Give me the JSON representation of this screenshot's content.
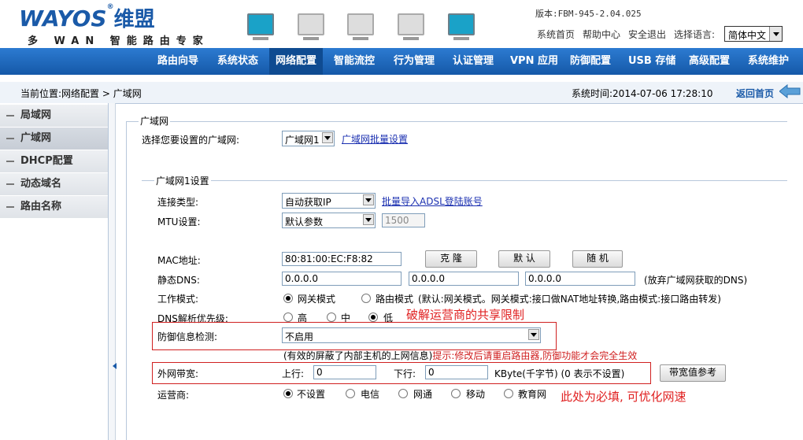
{
  "header": {
    "logo_text": "WAYOS",
    "logo_cn": "维盟",
    "logo_reg": "®",
    "tagline": "多 WAN 智能路由专家",
    "version": "版本:FBM-945-2.04.025",
    "links": [
      "系统首页",
      "帮助中心",
      "安全退出"
    ],
    "lang_label": "选择语言:",
    "lang_value": "简体中文"
  },
  "nav": {
    "items": [
      "路由向导",
      "系统状态",
      "网络配置",
      "智能流控",
      "行为管理",
      "认证管理",
      "VPN 应用",
      "防御配置",
      "USB 存储",
      "高级配置",
      "系统维护"
    ],
    "active": "网络配置"
  },
  "breadcrumb": {
    "text": "当前位置:网络配置 > 广域网",
    "system_time": "系统时间:2014-07-06 17:28:10",
    "back_label": "返回首页"
  },
  "sidebar": {
    "items": [
      "局域网",
      "广域网",
      "DHCP配置",
      "动态域名",
      "路由名称"
    ],
    "active": "广域网"
  },
  "wan": {
    "legend": "广域网",
    "select_label": "选择您要设置的广域网:",
    "select_value": "广域网1",
    "batch_link": "广域网批量设置"
  },
  "wan1": {
    "legend": "广域网1设置",
    "conn_label": "连接类型:",
    "conn_value": "自动获取IP",
    "conn_link": "批量导入ADSL登陆账号",
    "mtu_label": "MTU设置:",
    "mtu_value": "默认参数",
    "mtu_input": "1500",
    "mac_label": "MAC地址:",
    "mac_value": "80:81:00:EC:F8:82",
    "mac_buttons": [
      "克 隆",
      "默 认",
      "随 机"
    ],
    "dns_label": "静态DNS:",
    "dns_values": [
      "0.0.0.0",
      "0.0.0.0",
      "0.0.0.0"
    ],
    "dns_note": "(放弃广域网获取的DNS)",
    "mode_label": "工作模式:",
    "mode_options": [
      "网关模式",
      "路由模式"
    ],
    "mode_note": "(默认:网关模式。网关模式:接口做NAT地址转换,路由模式:接口路由转发)",
    "dnsprio_label": "DNS解析优先级:",
    "dnsprio_options": [
      "高",
      "中",
      "低"
    ],
    "annotation_crack": "破解运营商的共享限制",
    "defense_label": "防御信息检测:",
    "defense_value": "不启用",
    "defense_hint": "(有效的屏蔽了内部主机的上网信息)",
    "defense_hint_red": "提示:修改后请重启路由器,防御功能才会完全生效",
    "bw_label": "外网带宽:",
    "up_label": "上行:",
    "up_value": "0",
    "down_label": "下行:",
    "down_value": "0",
    "bw_unit": "KByte(千字节) (0 表示不设置)",
    "bw_button": "带宽值参考",
    "isp_label": "运营商:",
    "isp_options": [
      "不设置",
      "电信",
      "网通",
      "移动",
      "教育网"
    ],
    "annotation_isp": "此处为必填, 可优化网速"
  },
  "colors": {
    "nav_bg": "#1d64b6",
    "annotation_red": "#e02020",
    "link_blue": "#1a2fb0"
  }
}
